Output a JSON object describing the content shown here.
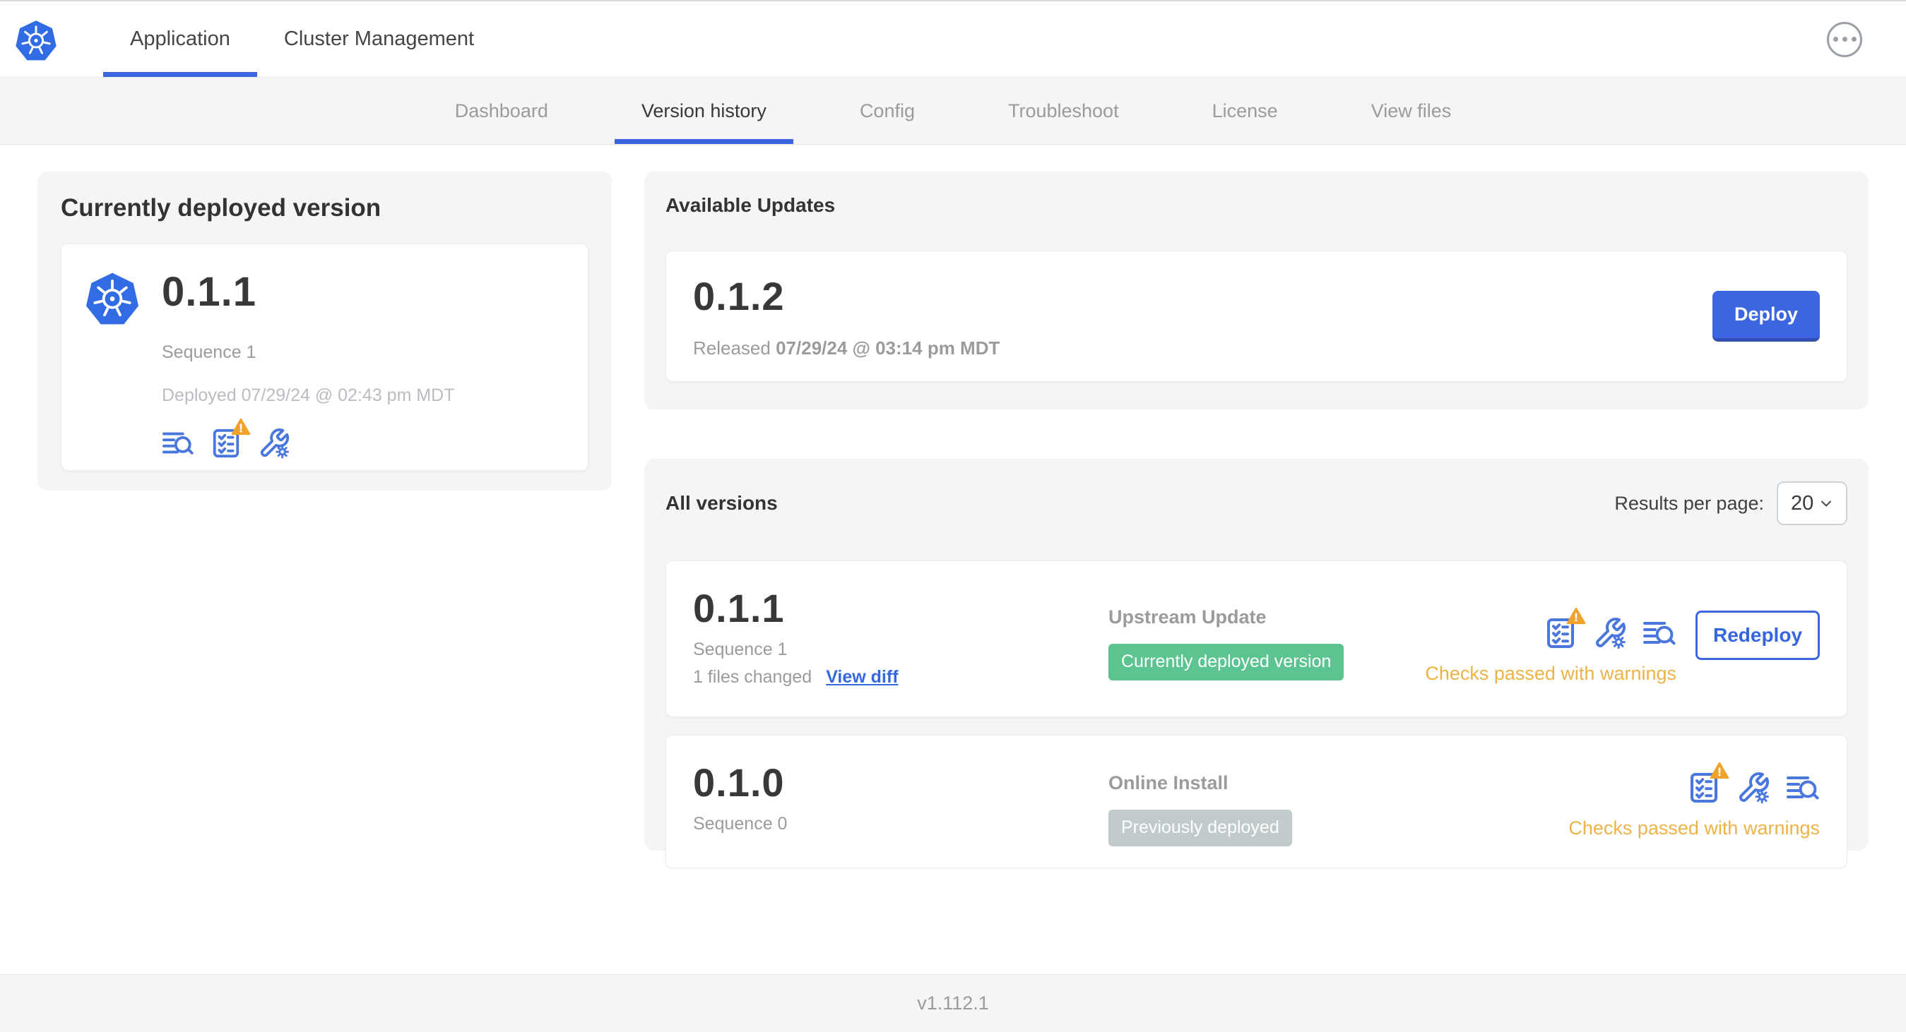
{
  "colors": {
    "accent_blue": "#3c66e0",
    "kubernetes_blue": "#326ce5",
    "icon_blue": "#4a77dd",
    "warning_amber": "#edb347",
    "warning_triangle": "#efa32b",
    "badge_green": "#5cc491",
    "badge_gray": "#c2cbcb",
    "panel_gray": "#f4f5f7"
  },
  "top_nav": {
    "tabs": [
      {
        "label": "Application"
      },
      {
        "label": "Cluster Management"
      }
    ],
    "more_menu_icon": "ellipsis-icon",
    "app_logo_icon": "kubernetes-logo"
  },
  "sub_nav": {
    "tabs": [
      {
        "label": "Dashboard"
      },
      {
        "label": "Version history"
      },
      {
        "label": "Config"
      },
      {
        "label": "Troubleshoot"
      },
      {
        "label": "License"
      },
      {
        "label": "View files"
      }
    ],
    "active_tab": "Version history"
  },
  "deployed_card": {
    "title": "Currently deployed version",
    "app_icon": "kubernetes-logo",
    "version": "0.1.1",
    "sequence": "Sequence 1",
    "deployed_at": "Deployed 07/29/24 @ 02:43 pm MDT",
    "icons": [
      "view-logs-icon",
      "preflight-checks-warning-icon",
      "edit-config-icon"
    ]
  },
  "available_updates": {
    "title": "Available Updates",
    "version": "0.1.2",
    "released_prefix": "Released",
    "released_date": "07/29/24 @ 03:14 pm MDT",
    "deploy_button": "Deploy"
  },
  "all_versions": {
    "title": "All versions",
    "results_per_page_label": "Results per page:",
    "results_per_page_value": "20",
    "rows": [
      {
        "version": "0.1.1",
        "sequence": "Sequence 1",
        "files_changed": "1 files changed",
        "view_diff": "View diff",
        "source": "Upstream Update",
        "badge": "Currently deployed version",
        "status": "Checks passed with warnings",
        "action": "Redeploy",
        "icons": [
          "preflight-checks-warning-icon",
          "edit-config-icon",
          "view-logs-icon"
        ]
      },
      {
        "version": "0.1.0",
        "sequence": "Sequence 0",
        "source": "Online Install",
        "badge": "Previously deployed",
        "status": "Checks passed with warnings",
        "icons": [
          "preflight-checks-warning-icon",
          "edit-config-icon",
          "view-logs-icon"
        ]
      }
    ]
  },
  "footer": {
    "app_version": "v1.112.1"
  }
}
